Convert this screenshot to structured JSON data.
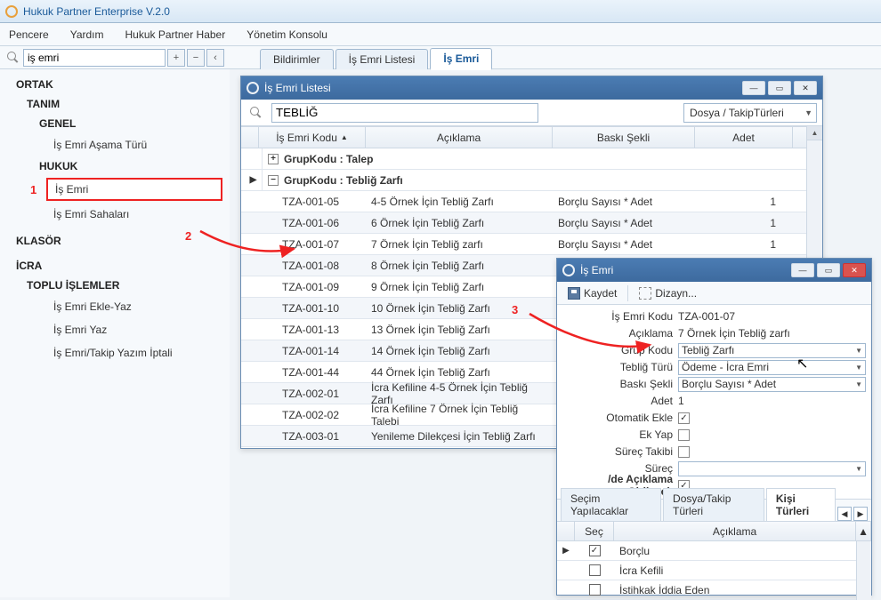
{
  "app": {
    "title": "Hukuk Partner Enterprise V.2.0"
  },
  "menu": {
    "pencere": "Pencere",
    "yardim": "Yardım",
    "haber": "Hukuk Partner Haber",
    "konsol": "Yönetim Konsolu"
  },
  "search": {
    "value": "iş emri",
    "plus": "+",
    "minus": "−",
    "back": "‹"
  },
  "tabs": {
    "bildirimler": "Bildirimler",
    "liste": "İş Emri Listesi",
    "isemri": "İş Emri"
  },
  "sidebar": {
    "ortak": "ORTAK",
    "tanim": "TANIM",
    "genel": "GENEL",
    "asama": "İş Emri Aşama Türü",
    "hukuk": "HUKUK",
    "isemri": "İş Emri",
    "sahalari": "İş Emri Sahaları",
    "klasor": "KLASÖR",
    "icra": "İCRA",
    "toplu": "TOPLU İŞLEMLER",
    "ekleyaz": "İş Emri Ekle-Yaz",
    "yaz": "İş Emri Yaz",
    "iptal": "İş Emri/Takip Yazım İptali"
  },
  "listwin": {
    "title": "İş Emri Listesi",
    "filter": "TEBLİĞ",
    "combo": "Dosya / TakipTürleri",
    "cols": {
      "kod": "İş Emri Kodu",
      "aciklama": "Açıklama",
      "baski": "Baskı Şekli",
      "adet": "Adet"
    },
    "group1": "GrupKodu : Talep",
    "group2": "GrupKodu : Tebliğ Zarfı",
    "rows": [
      {
        "kod": "TZA-001-05",
        "aci": "4-5 Örnek İçin Tebliğ Zarfı",
        "bas": "Borçlu Sayısı * Adet",
        "adet": "1"
      },
      {
        "kod": "TZA-001-06",
        "aci": "6 Örnek İçin Tebliğ Zarfı",
        "bas": "Borçlu Sayısı * Adet",
        "adet": "1"
      },
      {
        "kod": "TZA-001-07",
        "aci": "7 Örnek İçin Tebliğ zarfı",
        "bas": "Borçlu Sayısı * Adet",
        "adet": "1"
      },
      {
        "kod": "TZA-001-08",
        "aci": "8 Örnek İçin Tebliğ Zarfı",
        "bas": "",
        "adet": ""
      },
      {
        "kod": "TZA-001-09",
        "aci": "9 Örnek İçin Tebliğ Zarfı",
        "bas": "",
        "adet": ""
      },
      {
        "kod": "TZA-001-10",
        "aci": "10 Örnek İçin Tebliğ Zarfı",
        "bas": "",
        "adet": ""
      },
      {
        "kod": "TZA-001-13",
        "aci": "13 Örnek İçin Tebliğ Zarfı",
        "bas": "",
        "adet": ""
      },
      {
        "kod": "TZA-001-14",
        "aci": "14 Örnek İçin Tebliğ Zarfı",
        "bas": "",
        "adet": ""
      },
      {
        "kod": "TZA-001-44",
        "aci": "44 Örnek İçin Tebliğ Zarfı",
        "bas": "",
        "adet": ""
      },
      {
        "kod": "TZA-002-01",
        "aci": "İcra Kefiline 4-5 Örnek İçin Tebliğ Zarfı",
        "bas": "",
        "adet": ""
      },
      {
        "kod": "TZA-002-02",
        "aci": "İcra Kefiline 7 Örnek İçin Tebliğ Talebi",
        "bas": "",
        "adet": ""
      },
      {
        "kod": "TZA-003-01",
        "aci": "Yenileme Dilekçesi İçin Tebliğ Zarfı",
        "bas": "",
        "adet": ""
      }
    ]
  },
  "detwin": {
    "title": "İş Emri",
    "save": "Kaydet",
    "design": "Dizayn...",
    "labels": {
      "kod": "İş Emri Kodu",
      "aciklama": "Açıklama",
      "grup": "Grup Kodu",
      "teblig": "Tebliğ Türü",
      "baski": "Baskı Şekli",
      "adet": "Adet",
      "oto": "Otomatik Ekle",
      "ekyap": "Ek Yap",
      "surec_t": "Süreç Takibi",
      "surec": "Süreç",
      "girilecek": "/de Açıklama Girilecek"
    },
    "vals": {
      "kod": "TZA-001-07",
      "aciklama": "7 Örnek İçin Tebliğ zarfı",
      "grup": "Tebliğ Zarfı",
      "teblig": "Ödeme - İcra Emri",
      "baski": "Borçlu Sayısı * Adet",
      "adet": "1"
    },
    "tabs": {
      "secim": "Seçim Yapılacaklar",
      "dosya": "Dosya/Takip Türleri",
      "kisi": "Kişi Türleri"
    },
    "grid": {
      "sec": "Seç",
      "aciklama": "Açıklama",
      "rows": [
        {
          "checked": true,
          "txt": "Borçlu"
        },
        {
          "checked": false,
          "txt": "İcra Kefili"
        },
        {
          "checked": false,
          "txt": "İstihkak İddia Eden"
        }
      ]
    }
  },
  "annotations": {
    "n1": "1",
    "n2": "2",
    "n3": "3"
  }
}
